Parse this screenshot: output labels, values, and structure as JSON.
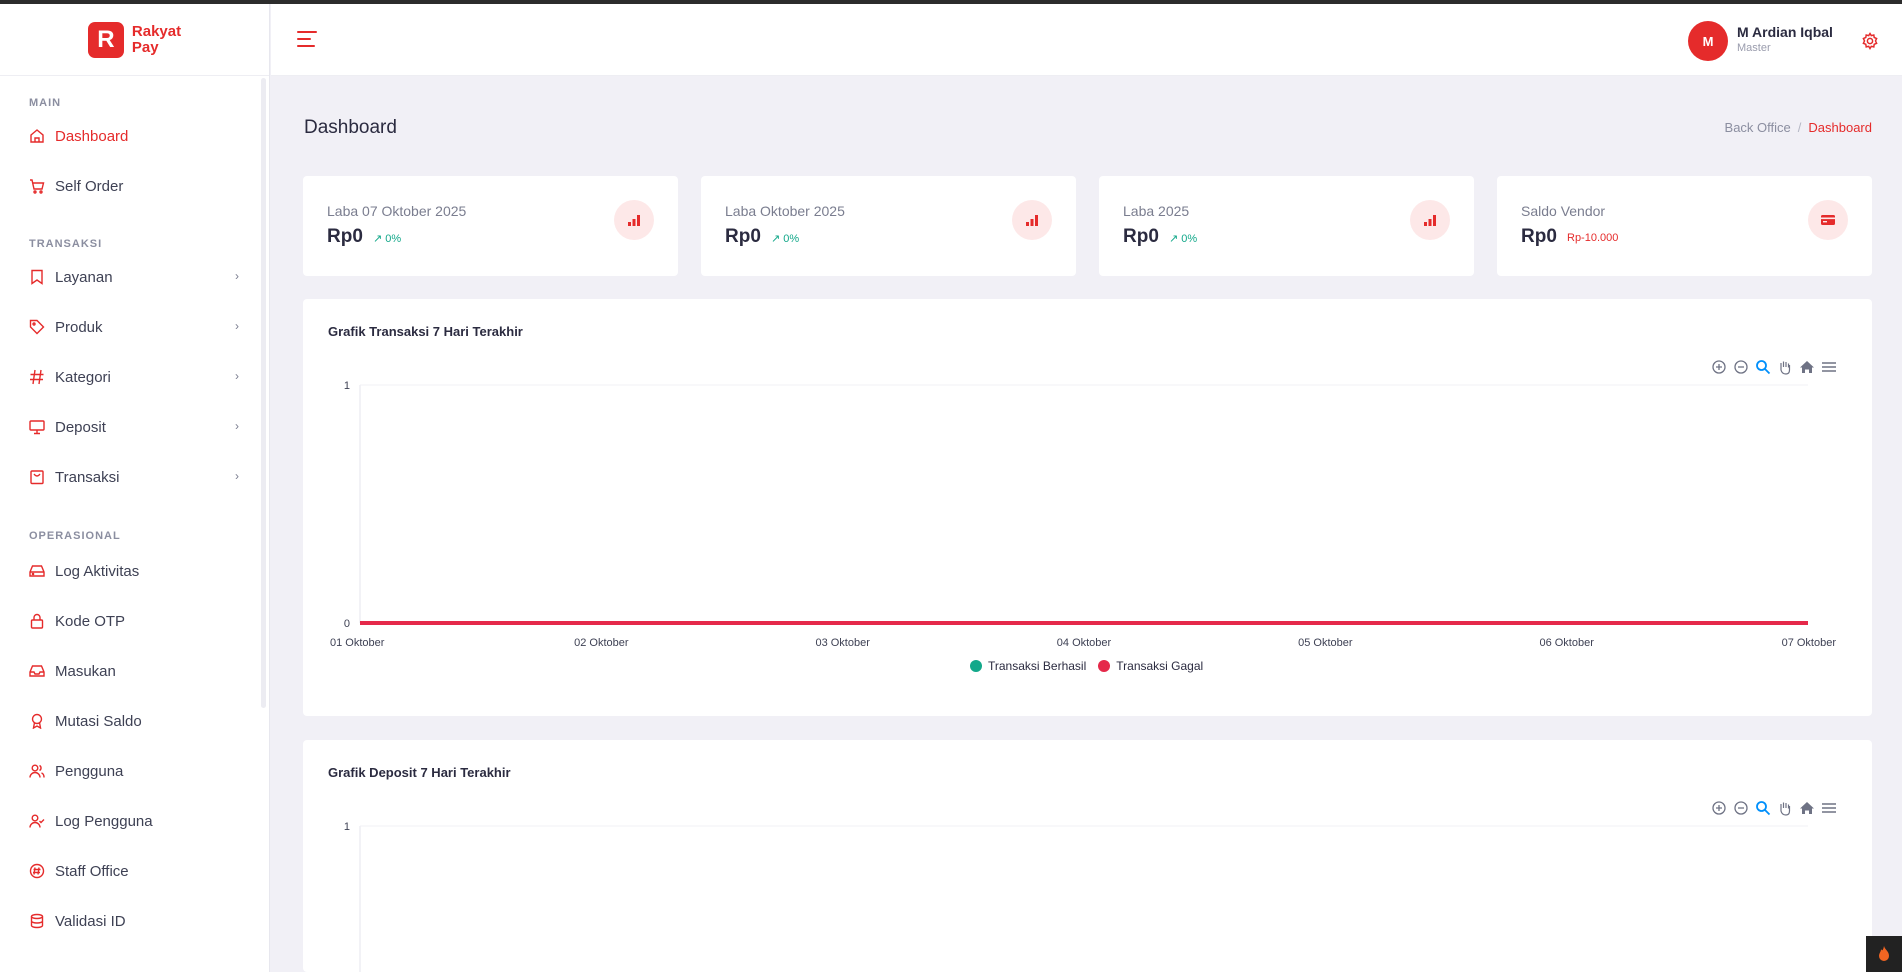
{
  "brand": {
    "name_line1": "Rakyat",
    "name_line2": "Pay",
    "logo_letter": "R",
    "color": "#e52b2b"
  },
  "header": {
    "user_initial": "M",
    "user_name": "M Ardian Iqbal",
    "user_role": "Master"
  },
  "sidebar": {
    "sections": [
      {
        "title": "MAIN"
      },
      {
        "title": "TRANSAKSI"
      },
      {
        "title": "OPERASIONAL"
      }
    ],
    "items": [
      {
        "label": "Dashboard",
        "active": true
      },
      {
        "label": "Self Order"
      },
      {
        "label": "Layanan",
        "chevron": "›"
      },
      {
        "label": "Produk",
        "chevron": "›"
      },
      {
        "label": "Kategori",
        "chevron": "›"
      },
      {
        "label": "Deposit",
        "chevron": "›"
      },
      {
        "label": "Transaksi",
        "chevron": "›"
      },
      {
        "label": "Log Aktivitas"
      },
      {
        "label": "Kode OTP"
      },
      {
        "label": "Masukan"
      },
      {
        "label": "Mutasi Saldo"
      },
      {
        "label": "Pengguna"
      },
      {
        "label": "Log Pengguna"
      },
      {
        "label": "Staff Office"
      },
      {
        "label": "Validasi ID"
      }
    ]
  },
  "page": {
    "title": "Dashboard",
    "breadcrumb": [
      "Back Office",
      "Dashboard"
    ],
    "breadcrumb_sep": "/"
  },
  "stats": [
    {
      "label": "Laba 07 Oktober 2025",
      "value": "Rp0",
      "trend": "0%",
      "trend_color": "#13a88a"
    },
    {
      "label": "Laba Oktober 2025",
      "value": "Rp0",
      "trend": "0%",
      "trend_color": "#13a88a"
    },
    {
      "label": "Laba 2025",
      "value": "Rp0",
      "trend": "0%",
      "trend_color": "#13a88a"
    },
    {
      "label": "Saldo Vendor",
      "value": "Rp0",
      "trend": "Rp-10.000",
      "trend_color": "#e52b2b"
    }
  ],
  "chart_data": [
    {
      "type": "line",
      "title": "Grafik Transaksi 7 Hari Terakhir",
      "categories": [
        "01 Oktober",
        "02 Oktober",
        "03 Oktober",
        "04 Oktober",
        "05 Oktober",
        "06 Oktober",
        "07 Oktober"
      ],
      "series": [
        {
          "name": "Transaksi Berhasil",
          "values": [
            0,
            0,
            0,
            0,
            0,
            0,
            0
          ],
          "color": "#13a88a"
        },
        {
          "name": "Transaksi Gagal",
          "values": [
            0,
            0,
            0,
            0,
            0,
            0,
            0
          ],
          "color": "#e5294a"
        }
      ],
      "ylim": [
        0,
        1
      ],
      "yticks": [
        "0",
        "1"
      ],
      "legend": "bottom-center",
      "grid": false
    },
    {
      "type": "line",
      "title": "Grafik Deposit 7 Hari Terakhir",
      "categories": [],
      "series": [],
      "ylim": [
        0,
        1
      ],
      "yticks": [
        "1"
      ],
      "grid": false
    }
  ],
  "chart_toolbar_icons": [
    "zoom-in-icon",
    "zoom-out-icon",
    "zoom-select-icon",
    "pan-hand-icon",
    "reset-home-icon",
    "menu-icon"
  ]
}
